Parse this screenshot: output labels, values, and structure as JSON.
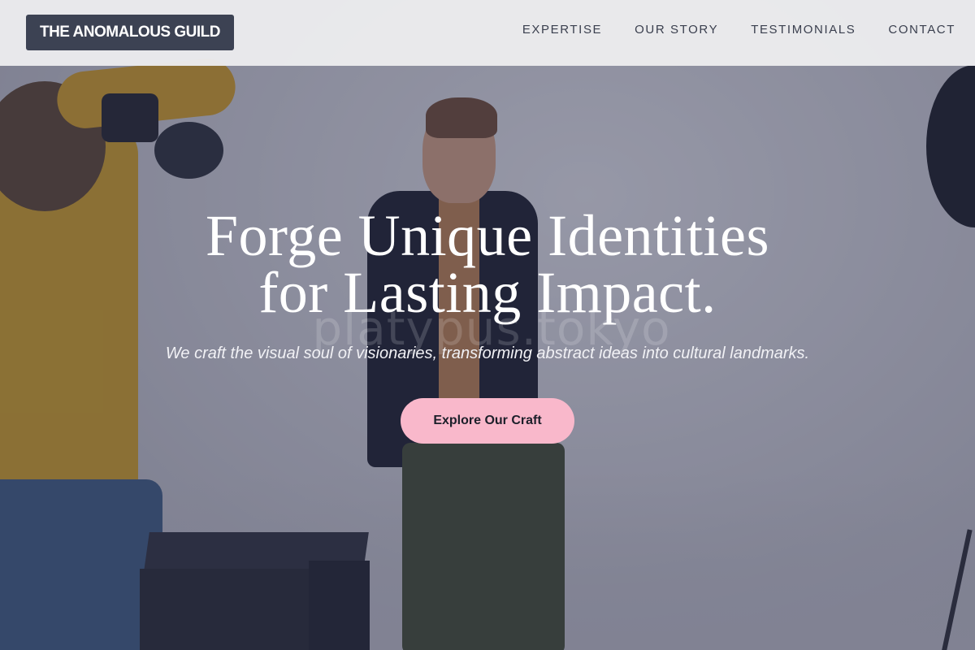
{
  "header": {
    "logo_text": "THE ANOMALOUS GUILD",
    "nav": [
      {
        "label": "EXPERTISE"
      },
      {
        "label": "OUR STORY"
      },
      {
        "label": "TESTIMONIALS"
      },
      {
        "label": "CONTACT"
      }
    ]
  },
  "hero": {
    "title_line1": "Forge Unique Identities",
    "title_line2": "for Lasting Impact.",
    "subtitle": "We craft the visual soul of visionaries, transforming abstract ideas into cultural landmarks.",
    "cta_label": "Explore Our Craft",
    "background_watermark": "platypus.tokyo"
  },
  "colors": {
    "logo_bg": "#3c4253",
    "cta_bg": "#f9b8cb",
    "nav_text": "#3a3f4e",
    "hero_text": "#ffffff"
  }
}
